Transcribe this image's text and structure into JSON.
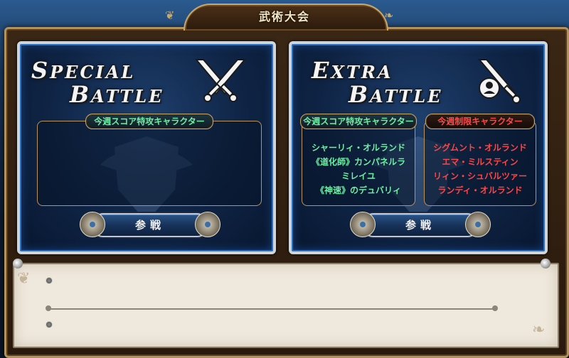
{
  "window": {
    "title": "武術大会"
  },
  "special": {
    "title_line1_cap": "S",
    "title_line1_rest": "PECIAL",
    "title_line2_cap": "B",
    "title_line2_rest": "ATTLE",
    "score_header": "今週スコア特攻キャラクター",
    "score_characters": [],
    "join_label": "参戦"
  },
  "extra": {
    "title_line1_cap": "E",
    "title_line1_rest": "XTRA",
    "title_line2_cap": "B",
    "title_line2_rest": "ATTLE",
    "score_header": "今週スコア特攻キャラクター",
    "score_characters": [
      "シャーリィ・オルランド",
      "《道化師》カンパネルラ",
      "ミレイユ",
      "《神速》のデュバリィ"
    ],
    "restrict_header": "今週制限キャラクター",
    "restrict_characters": [
      "シグムント・オルランド",
      "エマ・ミルスティン",
      "リィン・シュバルツァー",
      "ランディ・オルランド"
    ],
    "join_label": "参戦"
  },
  "colors": {
    "score_text": "#6ef0a2",
    "restrict_text": "#ff4545",
    "frame_gold": "#c9a86a"
  },
  "icons": {
    "special": "crossed-swords-icon",
    "extra": "sword-restriction-icon"
  }
}
